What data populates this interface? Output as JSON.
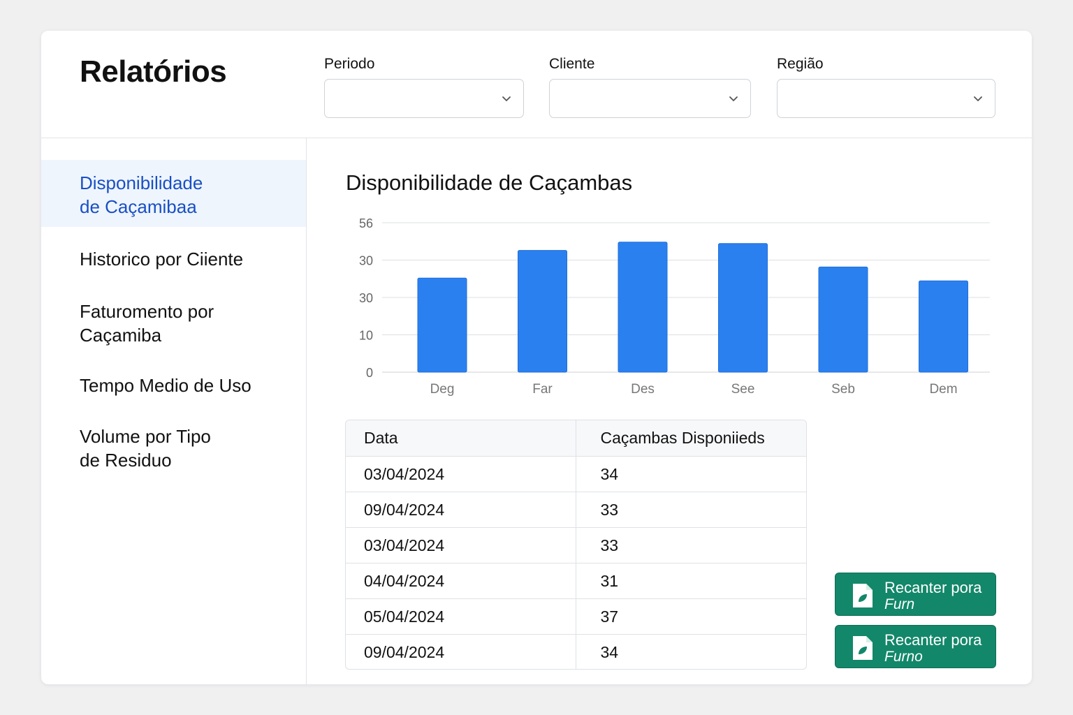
{
  "header": {
    "title": "Relatórios",
    "filters": [
      {
        "label": "Periodo",
        "value": ""
      },
      {
        "label": "Cliente",
        "value": ""
      },
      {
        "label": "Região",
        "value": ""
      }
    ]
  },
  "sidebar": {
    "items": [
      {
        "lines": [
          "Disponibilidade",
          "de Caçamibaa"
        ],
        "active": true
      },
      {
        "lines": [
          "Historico por Ciiente"
        ],
        "active": false
      },
      {
        "lines": [
          "Faturomento por",
          "Caçamiba"
        ],
        "active": false
      },
      {
        "lines": [
          "Tempo Medio de Uso"
        ],
        "active": false
      },
      {
        "lines": [
          "Volume por Tipo",
          "de Residuo"
        ],
        "active": false
      }
    ]
  },
  "main": {
    "chart_title": "Disponibilidade de Caçambas",
    "table": {
      "headers": [
        "Data",
        "Caçambas Disponiieds"
      ],
      "rows": [
        [
          "03/04/2024",
          "34"
        ],
        [
          "09/04/2024",
          "33"
        ],
        [
          "03/04/2024",
          "33"
        ],
        [
          "04/04/2024",
          "31"
        ],
        [
          "05/04/2024",
          "37"
        ],
        [
          "09/04/2024",
          "34"
        ]
      ]
    },
    "export_buttons": [
      {
        "line1": "Recanter pora",
        "line2": "Furn"
      },
      {
        "line1": "Recanter pora",
        "line2": "Furno"
      }
    ]
  },
  "colors": {
    "accent": "#1a4fc4",
    "bar": "#2b80f0",
    "active_bg": "#eef5fd",
    "button": "#13876a"
  },
  "chart_data": {
    "type": "bar",
    "title": "Disponibilidade de Caçambas",
    "categories": [
      "Deg",
      "Far",
      "Des",
      "See",
      "Seb",
      "Dem"
    ],
    "values": [
      34,
      44,
      47,
      46.5,
      38,
      33
    ],
    "y_ticks": [
      "0",
      "10",
      "30",
      "30",
      "56"
    ],
    "ylim": [
      0,
      54
    ],
    "grid": true
  }
}
